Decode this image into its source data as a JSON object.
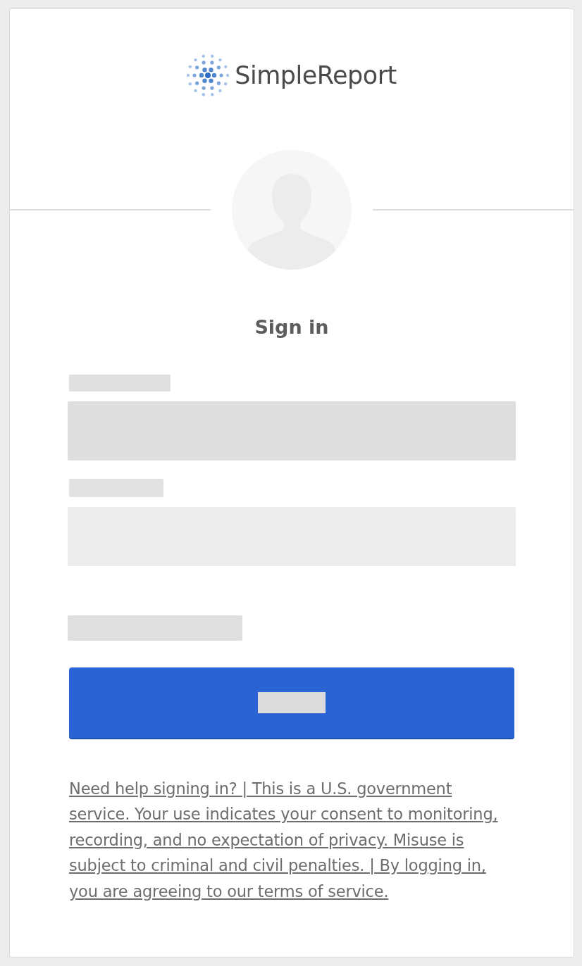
{
  "logo": {
    "text": "SimpleReport"
  },
  "heading": "Sign in",
  "footer_link": "Need help signing in? | This is a U.S. government service. Your use indicates your consent to monitoring, recording, and no expectation of privacy. Misuse is subject to criminal and civil penalties. | By logging in, you are agreeing to our terms of service."
}
